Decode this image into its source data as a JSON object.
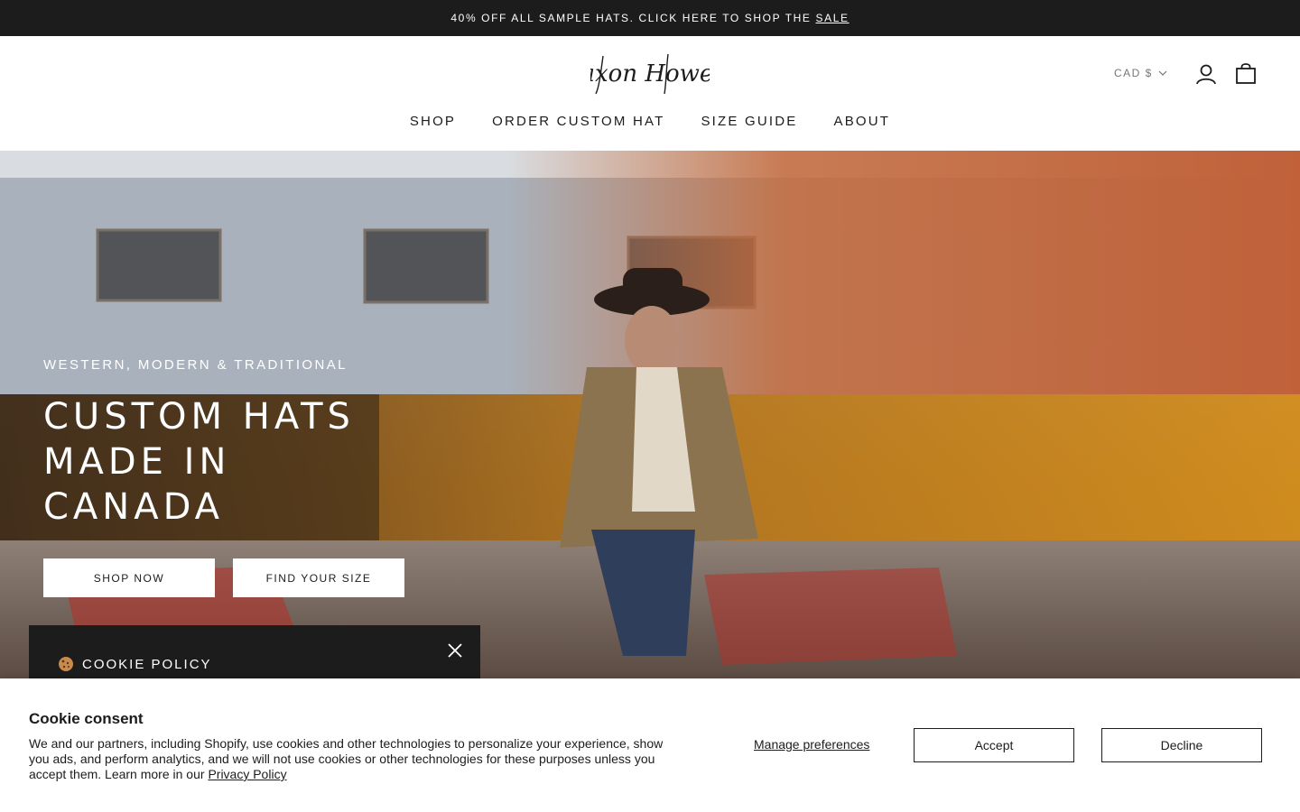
{
  "announcement": {
    "text": "40% OFF ALL SAMPLE HATS. CLICK HERE TO SHOP THE",
    "link": "SALE"
  },
  "header": {
    "logo_text": "Jaxon Howell",
    "currency": "CAD $",
    "icons": {
      "account": "account-icon",
      "cart": "cart-icon",
      "currency_caret": "chevron-down-icon"
    },
    "nav": [
      "SHOP",
      "ORDER CUSTOM HAT",
      "SIZE GUIDE",
      "ABOUT"
    ]
  },
  "hero": {
    "subtitle": "WESTERN, MODERN & TRADITIONAL",
    "title_lines": [
      "CUSTOM HATS",
      "MADE IN",
      "CANADA"
    ],
    "shop_button": "SHOP NOW",
    "size_button": "FIND YOUR SIZE"
  },
  "cookie_policy": {
    "title": "COOKIE POLICY",
    "icon": "cookie-icon",
    "close_icon": "close-icon"
  },
  "consent": {
    "title": "Cookie consent",
    "body": "We and our partners, including Shopify, use cookies and other technologies to personalize your experience, show you ads, and perform analytics, and we will not use cookies or other technologies for these purposes unless you accept them. Learn more in our",
    "privacy_link": "Privacy Policy",
    "manage": "Manage preferences",
    "accept": "Accept",
    "decline": "Decline"
  },
  "colors": {
    "dark": "#1c1c1c",
    "white": "#ffffff"
  }
}
